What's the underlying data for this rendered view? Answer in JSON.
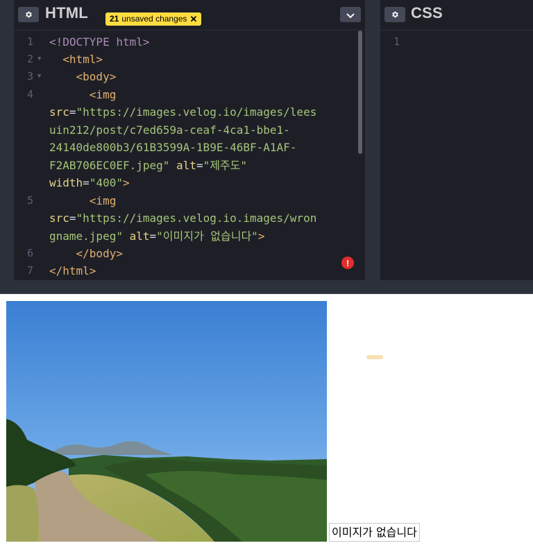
{
  "html_panel": {
    "title": "HTML",
    "unsaved_count": "21",
    "unsaved_label": "unsaved changes",
    "close_glyph": "✕",
    "gear_icon": "gear-icon",
    "collapse_icon": "chevron-down-icon",
    "error_glyph": "!"
  },
  "css_panel": {
    "title": "CSS",
    "gear_icon": "gear-icon",
    "line_number": "1"
  },
  "code": {
    "line_numbers": [
      "1",
      "2",
      "3",
      "4",
      "5",
      "6",
      "7"
    ],
    "lines": [
      [
        "<!DOCTYPE html>"
      ],
      [
        "  ",
        "<html>"
      ],
      [
        "    ",
        "<body>"
      ],
      [
        "      ",
        "<img"
      ],
      [
        "src",
        "=",
        "\"https://images.velog.io/images/lees"
      ],
      [
        "uin212/post/c7ed659a-ceaf-4ca1-bbe1-"
      ],
      [
        "24140de800b3/61B3599A-1B9E-46BF-A1AF-"
      ],
      [
        "F2AB706EC0EF.jpeg\"",
        " ",
        "alt",
        "=",
        "\"제주도\""
      ],
      [
        "width",
        "=",
        "\"400\"",
        ">"
      ],
      [
        "      ",
        "<img"
      ],
      [
        "src",
        "=",
        "\"https://images.velog.io.images/wron"
      ],
      [
        "gname.jpeg\"",
        " ",
        "alt",
        "=",
        "\"이미지가 없습니다\"",
        ">"
      ],
      [
        "    ",
        "</body>"
      ],
      [
        "</html>"
      ]
    ]
  },
  "preview": {
    "broken_image_alt": "이미지가 없습니다"
  },
  "colors": {
    "editor_bg": "#1e1f26",
    "badge_bg": "#ffdd40",
    "error_red": "#e52d2d",
    "tag": "#e0b070",
    "string": "#a5c57a",
    "attribute": "#e6d38a"
  }
}
